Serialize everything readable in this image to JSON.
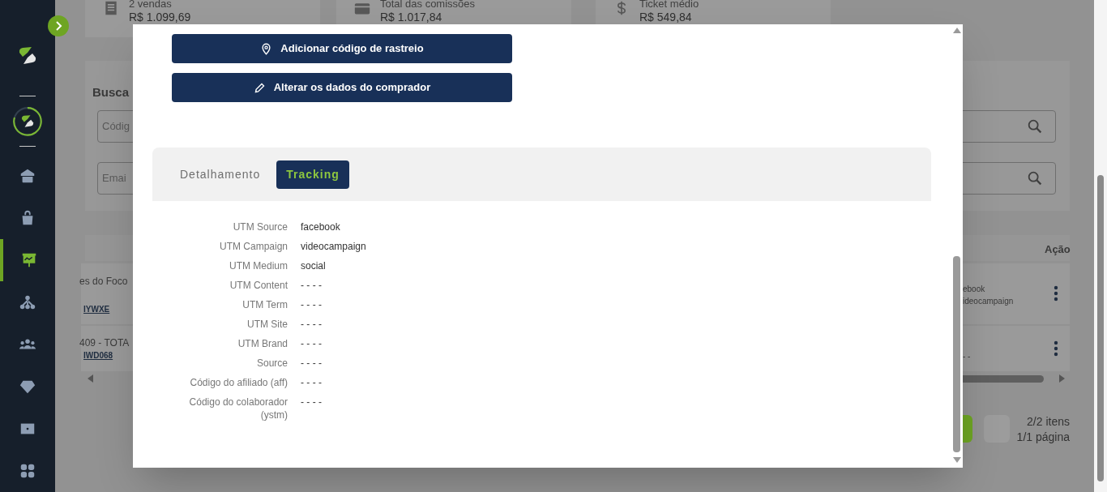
{
  "sidebar": {
    "items": [
      {
        "kind": "home",
        "selected": false
      },
      {
        "kind": "bag",
        "selected": false
      },
      {
        "kind": "presentation",
        "selected": true
      },
      {
        "kind": "network",
        "selected": false
      },
      {
        "kind": "users",
        "selected": false
      },
      {
        "kind": "diamond",
        "selected": false
      },
      {
        "kind": "ticket",
        "selected": false
      },
      {
        "kind": "grid",
        "selected": false
      }
    ]
  },
  "background": {
    "stats": [
      {
        "kind": "list",
        "caption": "2 vendas",
        "value": "R$ 1.099,69"
      },
      {
        "kind": "wallet",
        "caption": "Total das comissões",
        "value": "R$ 1.017,84"
      },
      {
        "kind": "dollar",
        "caption": "Ticket médio",
        "value": "R$ 549,84"
      }
    ],
    "search_title": "Busca",
    "search_fields": [
      {
        "placeholder": "Códig"
      },
      {
        "placeholder": "Emai"
      }
    ],
    "table": {
      "columns": [
        "Ação"
      ],
      "rows": [
        {
          "product": "es do Foco",
          "code": "IYWXE",
          "utm": [
            "ebook",
            "ideocampaign"
          ]
        },
        {
          "product": "409 - TOTA",
          "code": "IWD068",
          "utm": [
            "- -"
          ]
        }
      ]
    },
    "pagination": {
      "items": "2/2 itens",
      "pages": "1/1 página"
    }
  },
  "modal": {
    "actions": [
      {
        "kind": "location",
        "label": "Adicionar código de rastreio"
      },
      {
        "kind": "edit",
        "label": "Alterar os dados do comprador"
      }
    ],
    "tabs": [
      {
        "label": "Detalhamento",
        "selected": false
      },
      {
        "label": "Tracking",
        "selected": true
      }
    ],
    "tracking": [
      {
        "label": "UTM Source",
        "value": "facebook"
      },
      {
        "label": "UTM Campaign",
        "value": "videocampaign"
      },
      {
        "label": "UTM Medium",
        "value": "social"
      },
      {
        "label": "UTM Content",
        "value": "- - - -"
      },
      {
        "label": "UTM Term",
        "value": "- - - -"
      },
      {
        "label": "UTM Site",
        "value": "- - - -"
      },
      {
        "label": "UTM Brand",
        "value": "- - - -"
      },
      {
        "label": "Source",
        "value": "- - - -"
      },
      {
        "label": "Código do afiliado (aff)",
        "value": "- - - -"
      },
      {
        "label": "Código do colaborador (ystm)",
        "value": "- - - -"
      }
    ]
  }
}
